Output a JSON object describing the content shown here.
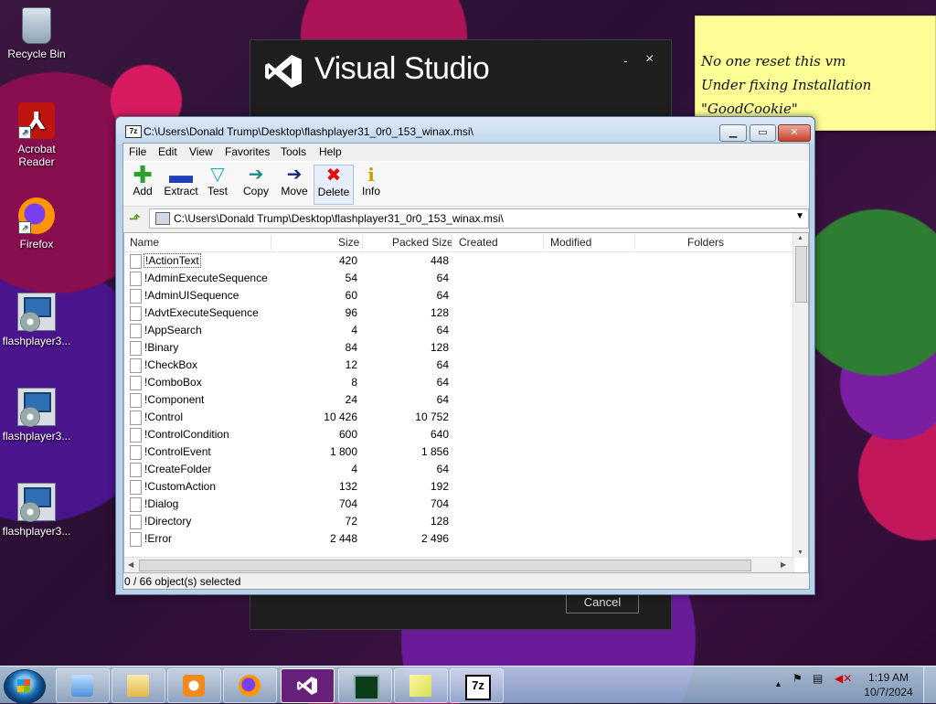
{
  "desktop": {
    "icons": [
      {
        "label": "Recycle Bin"
      },
      {
        "label": "Acrobat Reader"
      },
      {
        "label": "Firefox"
      },
      {
        "label": "flashplayer3..."
      },
      {
        "label": "flashplayer3..."
      },
      {
        "label": "flashplayer3..."
      }
    ]
  },
  "sticky": {
    "lines": [
      "No one reset this vm",
      "Under fixing Installation",
      "\"GoodCookie\""
    ]
  },
  "vs_installer": {
    "title": "Visual Studio",
    "minimize": "-",
    "close": "×",
    "cancel_label": "Cancel"
  },
  "sevenzip": {
    "title": "C:\\Users\\Donald Trump\\Desktop\\flashplayer31_0r0_153_winax.msi\\",
    "title_icon": "7z",
    "menu": [
      "File",
      "Edit",
      "View",
      "Favorites",
      "Tools",
      "Help"
    ],
    "toolbar": [
      {
        "label": "Add",
        "icon": "plus-icon"
      },
      {
        "label": "Extract",
        "icon": "minus-icon"
      },
      {
        "label": "Test",
        "icon": "check-icon"
      },
      {
        "label": "Copy",
        "icon": "arrow-right-teal-icon"
      },
      {
        "label": "Move",
        "icon": "arrow-right-blue-icon"
      },
      {
        "label": "Delete",
        "icon": "x-icon"
      },
      {
        "label": "Info",
        "icon": "info-icon"
      }
    ],
    "address": "C:\\Users\\Donald Trump\\Desktop\\flashplayer31_0r0_153_winax.msi\\",
    "columns": [
      "Name",
      "Size",
      "Packed Size",
      "Created",
      "Modified",
      "Folders"
    ],
    "rows": [
      {
        "name": "!ActionText",
        "size": "420",
        "packed": "448"
      },
      {
        "name": "!AdminExecuteSequence",
        "size": "54",
        "packed": "64"
      },
      {
        "name": "!AdminUISequence",
        "size": "60",
        "packed": "64"
      },
      {
        "name": "!AdvtExecuteSequence",
        "size": "96",
        "packed": "128"
      },
      {
        "name": "!AppSearch",
        "size": "4",
        "packed": "64"
      },
      {
        "name": "!Binary",
        "size": "84",
        "packed": "128"
      },
      {
        "name": "!CheckBox",
        "size": "12",
        "packed": "64"
      },
      {
        "name": "!ComboBox",
        "size": "8",
        "packed": "64"
      },
      {
        "name": "!Component",
        "size": "24",
        "packed": "64"
      },
      {
        "name": "!Control",
        "size": "10 426",
        "packed": "10 752"
      },
      {
        "name": "!ControlCondition",
        "size": "600",
        "packed": "640"
      },
      {
        "name": "!ControlEvent",
        "size": "1 800",
        "packed": "1 856"
      },
      {
        "name": "!CreateFolder",
        "size": "4",
        "packed": "64"
      },
      {
        "name": "!CustomAction",
        "size": "132",
        "packed": "192"
      },
      {
        "name": "!Dialog",
        "size": "704",
        "packed": "704"
      },
      {
        "name": "!Directory",
        "size": "72",
        "packed": "128"
      },
      {
        "name": "!Error",
        "size": "2 448",
        "packed": "2 496"
      }
    ],
    "status": "0 / 66 object(s) selected"
  },
  "taskbar": {
    "buttons": [
      "windows-explorer-like-icon",
      "file-explorer-icon",
      "media-player-icon",
      "firefox-icon",
      "visual-studio-icon",
      "task-manager-icon",
      "sticky-notes-icon",
      "7zip-icon"
    ],
    "clock_time": "1:19 AM",
    "clock_date": "10/7/2024"
  }
}
